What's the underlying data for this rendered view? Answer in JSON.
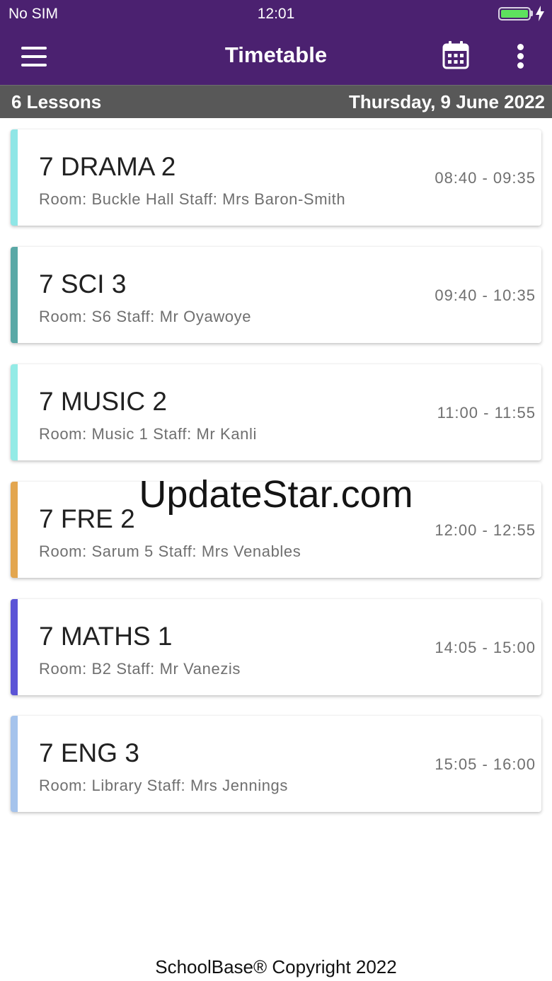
{
  "status_bar": {
    "carrier": "No SIM",
    "time": "12:01"
  },
  "app_bar": {
    "title": "Timetable",
    "icons": [
      "menu-icon",
      "calendar-icon",
      "more-vertical-icon"
    ]
  },
  "summary": {
    "lesson_count": "6 Lessons",
    "date": "Thursday, 9 June 2022"
  },
  "lessons": [
    {
      "name": "7 DRAMA 2",
      "details": "Room: Buckle Hall Staff: Mrs Baron-Smith",
      "time": "08:40 - 09:35",
      "color": "#8fe6e6"
    },
    {
      "name": "7 SCI 3",
      "details": "Room: S6 Staff: Mr Oyawoye",
      "time": "09:40 - 10:35",
      "color": "#5aa8a6"
    },
    {
      "name": "7 MUSIC 2",
      "details": "Room: Music 1 Staff: Mr Kanli",
      "time": "11:00 - 11:55",
      "color": "#93ebe6"
    },
    {
      "name": "7 FRE 2",
      "details": "Room: Sarum 5 Staff: Mrs Venables",
      "time": "12:00 - 12:55",
      "color": "#e3a64f"
    },
    {
      "name": "7 MATHS 1",
      "details": "Room: B2 Staff: Mr Vanezis",
      "time": "14:05 - 15:00",
      "color": "#5b54d6"
    },
    {
      "name": "7 ENG 3",
      "details": "Room: Library Staff: Mrs Jennings",
      "time": "15:05 - 16:00",
      "color": "#a5c3ec"
    }
  ],
  "watermark": "UpdateStar.com",
  "footer": "SchoolBase® Copyright 2022",
  "colors": {
    "primary": "#4b2170",
    "sub_bar": "#585858",
    "battery": "#5ee15e"
  }
}
